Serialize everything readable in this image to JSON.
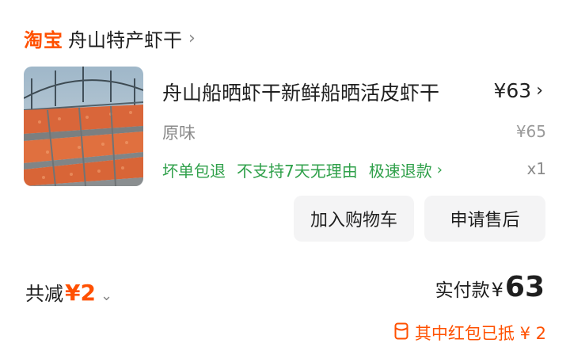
{
  "store": {
    "logo": "淘宝",
    "name": "舟山特产虾干",
    "chevron": "›"
  },
  "product": {
    "title": "舟山船晒虾干新鲜船晒活皮虾干",
    "price": "¥63",
    "price_chevron": "›",
    "spec": "原味",
    "original_price": "¥65",
    "services": [
      "坏单包退",
      "不支持7天无理由",
      "极速退款"
    ],
    "services_chevron": "›",
    "quantity": "x1",
    "image_icon": "dried-shrimp-photo"
  },
  "buttons": {
    "add_to_cart": "加入购物车",
    "after_sale": "申请售后"
  },
  "summary": {
    "discount_label": "共减",
    "discount_amount": "¥2",
    "discount_chevron": "⌄",
    "paid_label": "实付款",
    "paid_currency": "¥",
    "paid_amount": "63",
    "redpack_text": "其中红包已抵 ¥ 2",
    "redpack_icon": "red-packet-icon"
  },
  "colors": {
    "accent": "#ff5000",
    "service_green": "#2fa04a",
    "button_bg": "#f4f4f5"
  }
}
